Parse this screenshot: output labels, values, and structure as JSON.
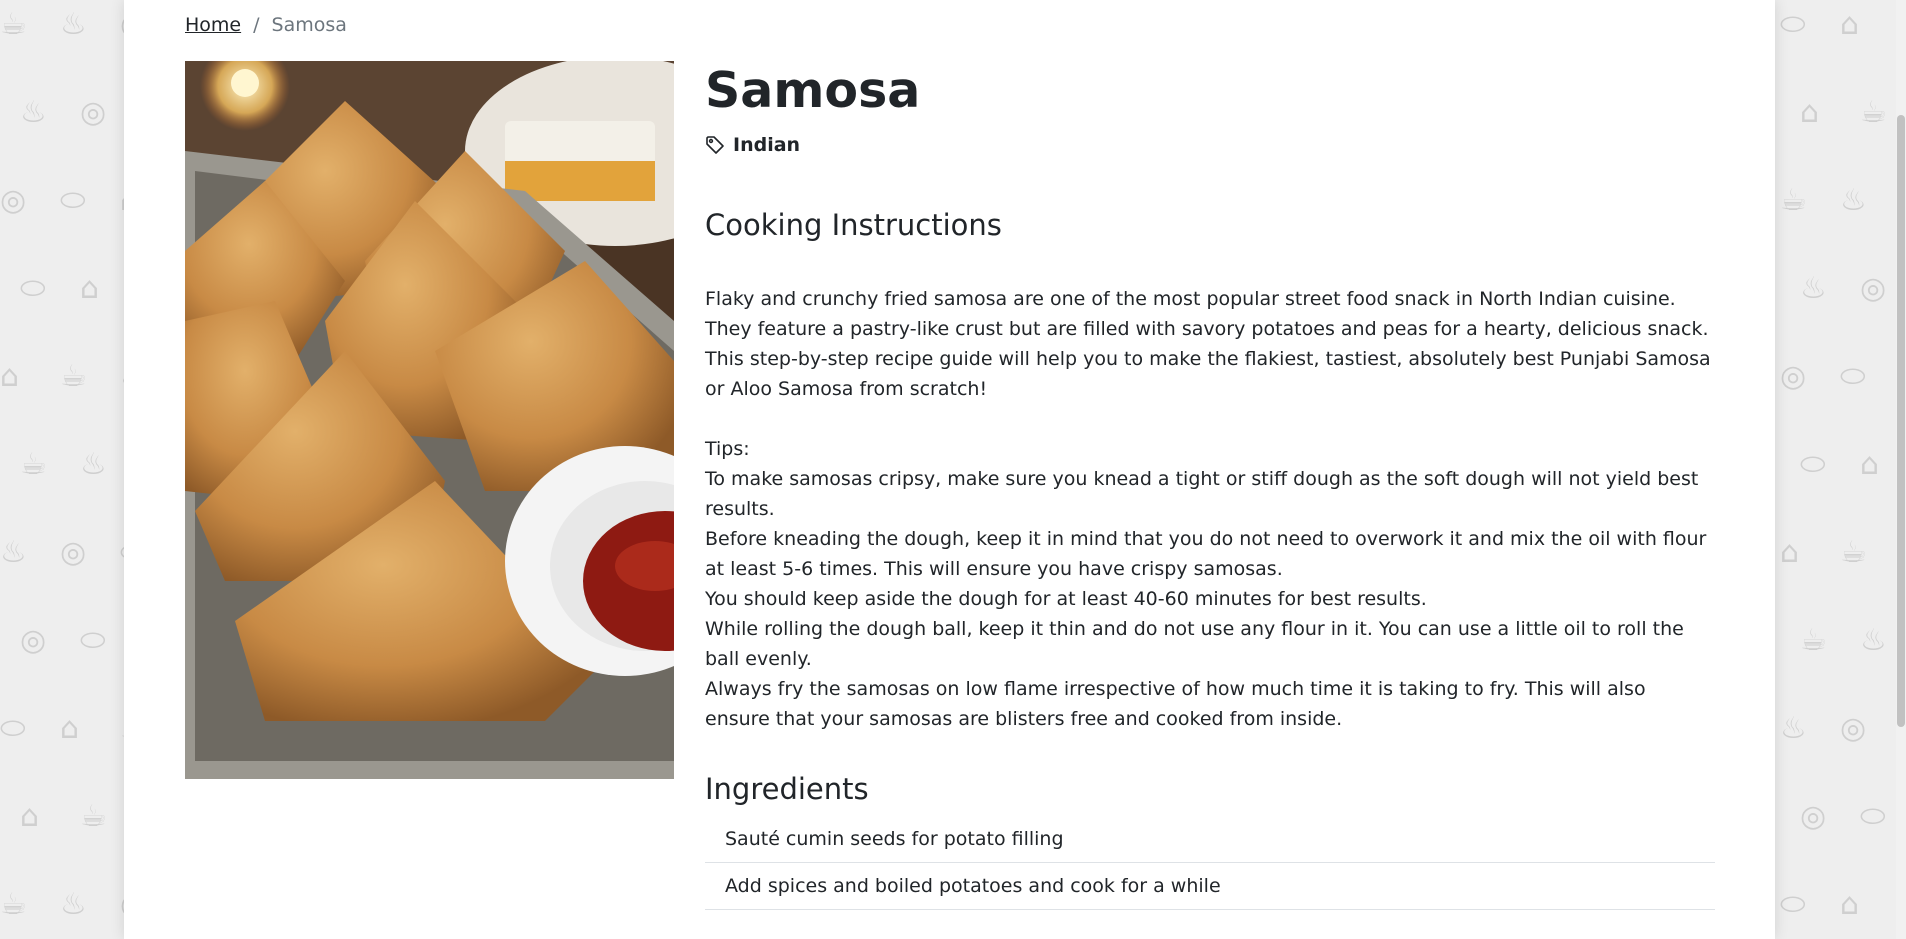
{
  "breadcrumb": {
    "home": "Home",
    "separator": "/",
    "current": "Samosa"
  },
  "recipe": {
    "title": "Samosa",
    "tag_icon": "tag-icon",
    "cuisine": "Indian",
    "image_alt": "Samosa"
  },
  "instructions": {
    "title": "Cooking Instructions",
    "intro": [
      "Flaky and crunchy fried samosa are one of the most popular street food snack in North Indian cuisine.",
      "They feature a pastry-like crust but are filled with savory potatoes and peas for a hearty, delicious snack.",
      "This step-by-step recipe guide will help you to make the flakiest, tastiest, absolutely best Punjabi Samosa or Aloo Samosa from scratch!"
    ],
    "tips_label": "Tips:",
    "tips": [
      "To make samosas cripsy, make sure you knead a tight or stiff dough as the soft dough will not yield best results.",
      "Before kneading the dough, keep it in mind that you do not need to overwork it and mix the oil with flour at least 5-6 times. This will ensure you have crispy samosas.",
      "You should keep aside the dough for at least 40-60 minutes for best results.",
      "While rolling the dough ball, keep it thin and do not use any flour in it. You can use a little oil to roll the ball evenly.",
      "Always fry the samosas on low flame irrespective of how much time it is taking to fry. This will also ensure that your samosas are blisters free and cooked from inside."
    ]
  },
  "ingredients": {
    "title": "Ingredients",
    "items": [
      "Sauté cumin seeds for potato filling",
      "Add spices and boiled potatoes and cook for a while"
    ]
  }
}
